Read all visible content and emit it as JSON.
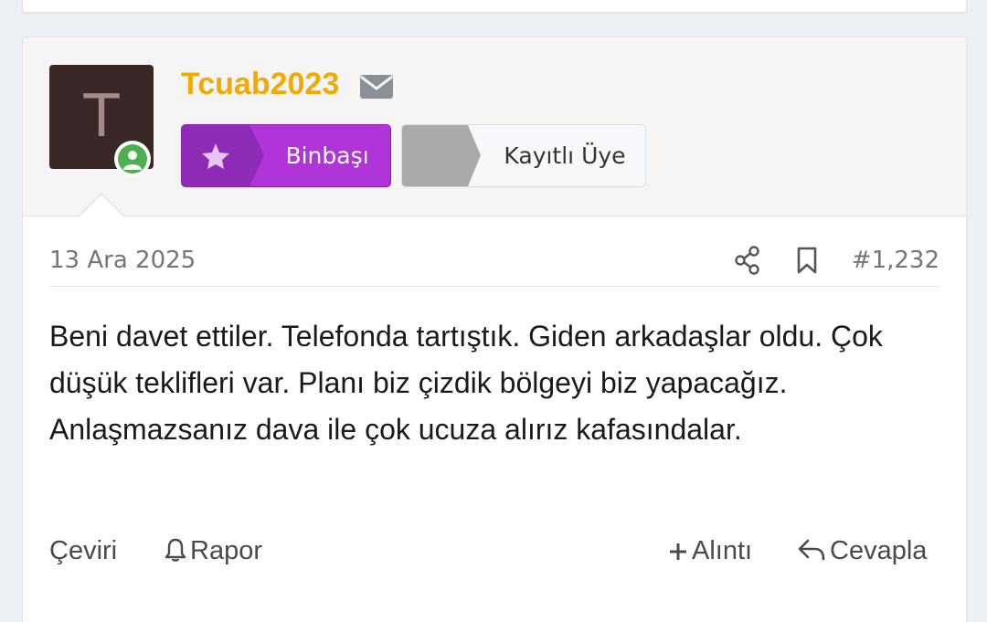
{
  "post": {
    "username": "Tcuab2023",
    "avatar_letter": "T",
    "rank_badge": "Binbaşı",
    "member_badge": "Kayıtlı Üye",
    "date": "13 Ara 2025",
    "post_number": "#1,232",
    "body": "Beni davet ettiler. Telefonda tartıştık. Giden arkadaşlar oldu. Çok düşük teklifleri var. Planı biz çizdik bölgeyi biz yapacağız. Anlaşmazsanız dava ile çok ucuza alırız kafasındalar."
  },
  "actions": {
    "translate": "Çeviri",
    "report": "Rapor",
    "quote": "Alıntı",
    "reply": "Cevapla"
  },
  "icons": {
    "mail": "mail-icon",
    "star": "star-icon",
    "online": "online-status-icon",
    "share": "share-icon",
    "bookmark": "bookmark-icon",
    "bell": "bell-icon",
    "plus": "plus-icon",
    "reply": "reply-icon"
  },
  "colors": {
    "username": "#f2a900",
    "rank_badge": "#b035d8",
    "online": "#4caf50"
  }
}
